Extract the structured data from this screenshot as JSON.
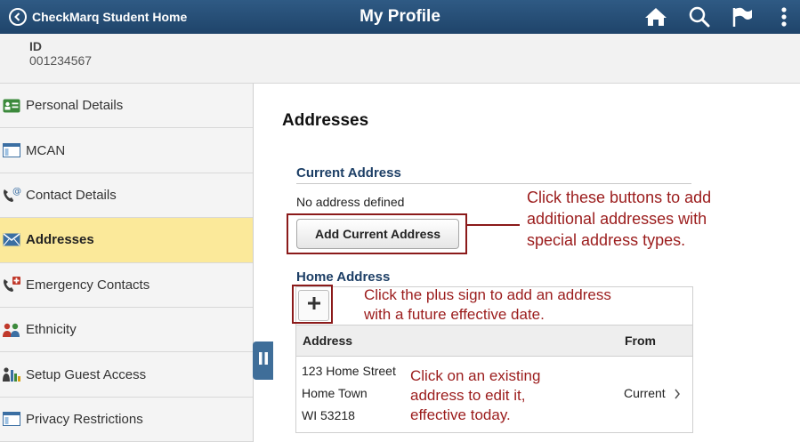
{
  "header": {
    "back_label": "CheckMarq Student Home",
    "title": "My Profile",
    "icons": [
      "home-icon",
      "search-icon",
      "flag-icon",
      "more-vertical-icon"
    ],
    "color": "#2a5179"
  },
  "id_section": {
    "label": "ID",
    "value": "001234567"
  },
  "sidebar": {
    "items": [
      {
        "label": "Personal Details",
        "icon": "id-card-icon"
      },
      {
        "label": "MCAN",
        "icon": "window-icon"
      },
      {
        "label": "Contact Details",
        "icon": "phone-at-icon"
      },
      {
        "label": "Addresses",
        "icon": "envelope-icon",
        "active": true
      },
      {
        "label": "Emergency Contacts",
        "icon": "phone-cross-icon"
      },
      {
        "label": "Ethnicity",
        "icon": "people-icon"
      },
      {
        "label": "Setup Guest Access",
        "icon": "guest-access-icon"
      },
      {
        "label": "Privacy Restrictions",
        "icon": "window-icon"
      }
    ],
    "active_color": "#fbe99a"
  },
  "main": {
    "heading": "Addresses",
    "current_address": {
      "title": "Current Address",
      "empty_text": "No address defined",
      "add_button": "Add Current Address"
    },
    "home_address": {
      "title": "Home Address",
      "columns": [
        "Address",
        "From"
      ],
      "rows": [
        {
          "address_lines": [
            "123 Home Street",
            "Home Town",
            "WI 53218"
          ],
          "from": "Current"
        }
      ]
    }
  },
  "annotations": {
    "add_buttons": [
      "Click these buttons to add",
      "additional addresses with",
      "special address types."
    ],
    "plus_sign": [
      "Click the plus sign to add an address",
      "with a future effective date."
    ],
    "existing": [
      "Click on an existing",
      "address to edit it,",
      "effective today."
    ],
    "color": "#9b1c1c"
  }
}
